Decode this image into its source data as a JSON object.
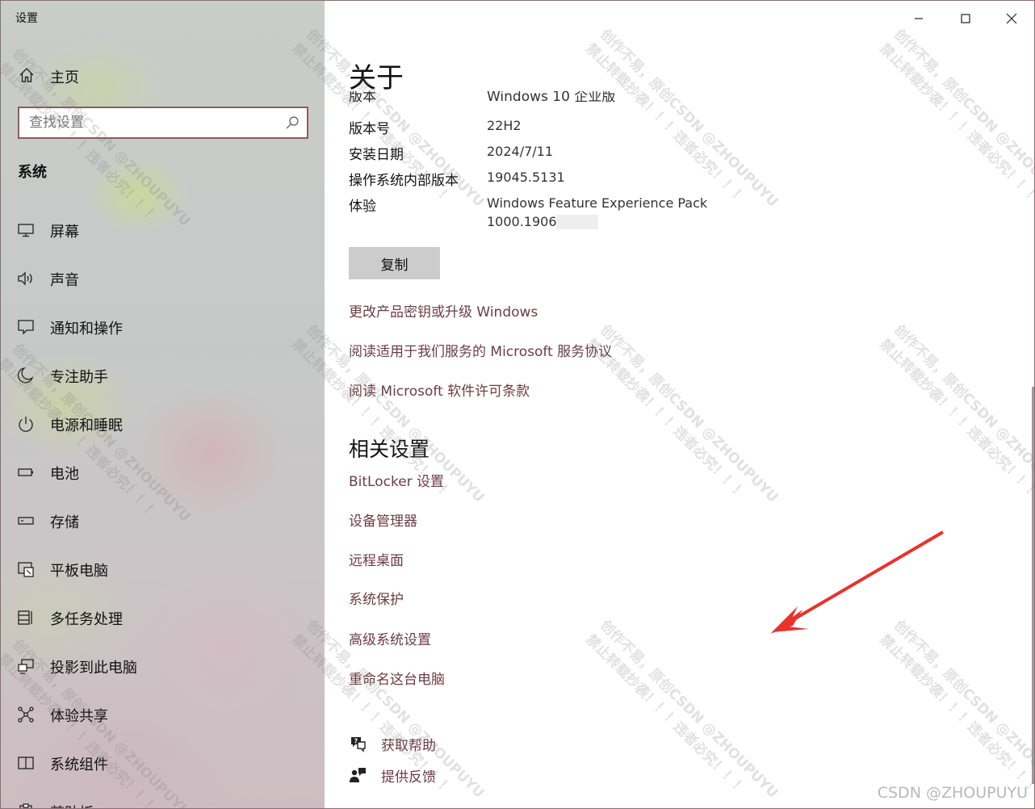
{
  "window": {
    "title": "设置",
    "controls": [
      "minimize",
      "maximize",
      "close"
    ]
  },
  "sidebar": {
    "home_label": "主页",
    "search_placeholder": "查找设置",
    "section_title": "系统",
    "items": [
      {
        "label": "屏幕",
        "icon": "monitor-icon"
      },
      {
        "label": "声音",
        "icon": "speaker-icon"
      },
      {
        "label": "通知和操作",
        "icon": "notification-icon"
      },
      {
        "label": "专注助手",
        "icon": "moon-icon"
      },
      {
        "label": "电源和睡眠",
        "icon": "power-icon"
      },
      {
        "label": "电池",
        "icon": "battery-icon"
      },
      {
        "label": "存储",
        "icon": "storage-icon"
      },
      {
        "label": "平板电脑",
        "icon": "tablet-icon"
      },
      {
        "label": "多任务处理",
        "icon": "multitask-icon"
      },
      {
        "label": "投影到此电脑",
        "icon": "project-icon"
      },
      {
        "label": "体验共享",
        "icon": "share-icon"
      },
      {
        "label": "系统组件",
        "icon": "components-icon"
      },
      {
        "label": "剪贴板",
        "icon": "clipboard-icon"
      }
    ]
  },
  "main": {
    "title": "关于",
    "clipped_row": {
      "label": "版本",
      "value": "Windows 10 企业版"
    },
    "specs": [
      {
        "label": "版本号",
        "value": "22H2"
      },
      {
        "label": "安装日期",
        "value": "2024/7/11"
      },
      {
        "label": "操作系统内部版本",
        "value": "19045.5131"
      },
      {
        "label": "体验",
        "value": "Windows Feature Experience Pack",
        "value2": "1000.19060."
      }
    ],
    "copy_button": "复制",
    "links": [
      "更改产品密钥或升级 Windows",
      "阅读适用于我们服务的 Microsoft 服务协议",
      "阅读 Microsoft 软件许可条款"
    ],
    "related_title": "相关设置",
    "related_links": [
      "BitLocker 设置",
      "设备管理器",
      "远程桌面",
      "系统保护",
      "高级系统设置",
      "重命名这台电脑"
    ],
    "help": [
      {
        "label": "获取帮助",
        "icon": "help-chat-icon"
      },
      {
        "label": "提供反馈",
        "icon": "feedback-icon"
      }
    ]
  },
  "watermark": {
    "line1": "创作不易，原创CSDN @ZHOUPUYU",
    "line2": "禁止转载抄袭！！！违者必究！！！",
    "corner": "CSDN @ZHOUPUYU"
  },
  "colors": {
    "link": "#6b3d45",
    "accent_border": "#8d5a63",
    "arrow": "#e8322c"
  }
}
